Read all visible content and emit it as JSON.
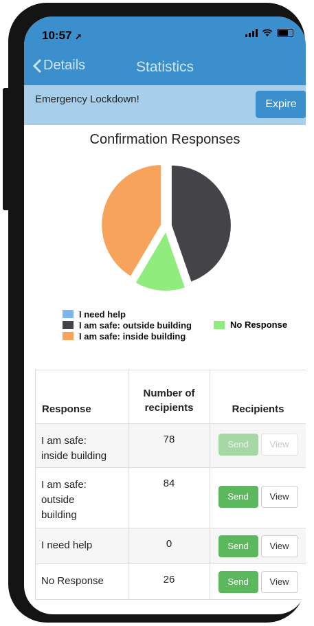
{
  "status": {
    "time": "10:57"
  },
  "nav": {
    "back_label": "Details",
    "title": "Statistics"
  },
  "banner": {
    "message": "Emergency Lockdown!",
    "expire_label": "Expire"
  },
  "chart_title": "Confirmation Responses",
  "chart_data": {
    "type": "pie",
    "title": "Confirmation Responses",
    "slices": [
      {
        "name": "I need help",
        "value": 0,
        "color": "#7cb5ec"
      },
      {
        "name": "I am safe: outside building",
        "value": 84,
        "color": "#434348"
      },
      {
        "name": "No Response",
        "value": 26,
        "color": "#90ed7d"
      },
      {
        "name": "I am safe: inside building",
        "value": 78,
        "color": "#f7a35c"
      }
    ],
    "legend": "bottom"
  },
  "legend": {
    "need_help": "I need help",
    "outside": "I am safe: outside building",
    "inside": "I am safe: inside building",
    "no_response": "No Response"
  },
  "table": {
    "headers": {
      "response": "Response",
      "count": "Number of recipients",
      "recipients": "Recipients"
    },
    "rows": [
      {
        "response": "I am safe: inside building",
        "count": "78",
        "send": "Send",
        "view": "View",
        "enabled": false
      },
      {
        "response": "I am safe: outside building",
        "count": "84",
        "send": "Send",
        "view": "View",
        "enabled": true
      },
      {
        "response": "I need help",
        "count": "0",
        "send": "Send",
        "view": "View",
        "enabled": true
      },
      {
        "response": "No Response",
        "count": "26",
        "send": "Send",
        "view": "View",
        "enabled": true
      }
    ]
  }
}
